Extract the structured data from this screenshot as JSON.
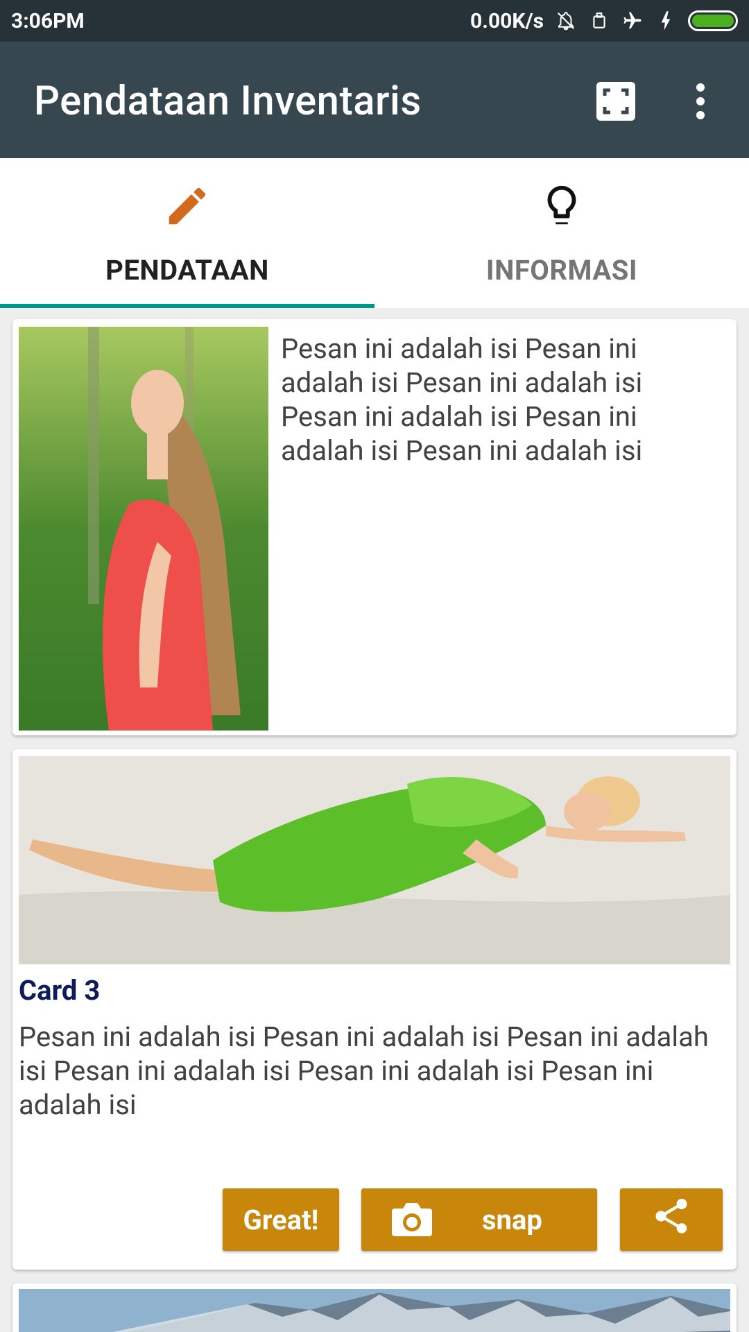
{
  "status_bar": {
    "time": "3:06PM",
    "speed": "0.00K/s",
    "icons": [
      "bell-off-icon",
      "sim-icon",
      "airplane-icon",
      "charging-icon",
      "battery-icon"
    ]
  },
  "toolbar": {
    "title": "Pendataan Inventaris",
    "actions": [
      "fullscreen-icon",
      "more-vert-icon"
    ]
  },
  "tabs": [
    {
      "label": "PENDATAAN",
      "icon": "pencil-icon",
      "active": true,
      "icon_color": "#d2691e"
    },
    {
      "label": "INFORMASI",
      "icon": "lightbulb-icon",
      "active": false,
      "icon_color": "#111111"
    }
  ],
  "cards": [
    {
      "image": "woman-red-shirt-photo",
      "text": "Pesan ini adalah isi Pesan ini adalah isi Pesan ini adalah isi Pesan ini adalah isi Pesan ini adalah isi Pesan ini adalah isi"
    },
    {
      "image": "woman-green-dress-sand-photo",
      "heading": "Card 3",
      "text": "Pesan ini adalah isi Pesan ini adalah isi Pesan ini adalah isi Pesan ini adalah isi Pesan ini adalah isi Pesan ini adalah isi",
      "buttons": {
        "great": "Great!",
        "snap": "snap",
        "share": "share-icon"
      }
    },
    {
      "image": "mountain-landscape-photo"
    }
  ],
  "colors": {
    "status_bar": "#263238",
    "toolbar": "#37474f",
    "tab_indicator": "#009688",
    "button": "#c8860a",
    "card_heading": "#0d1a5c"
  }
}
